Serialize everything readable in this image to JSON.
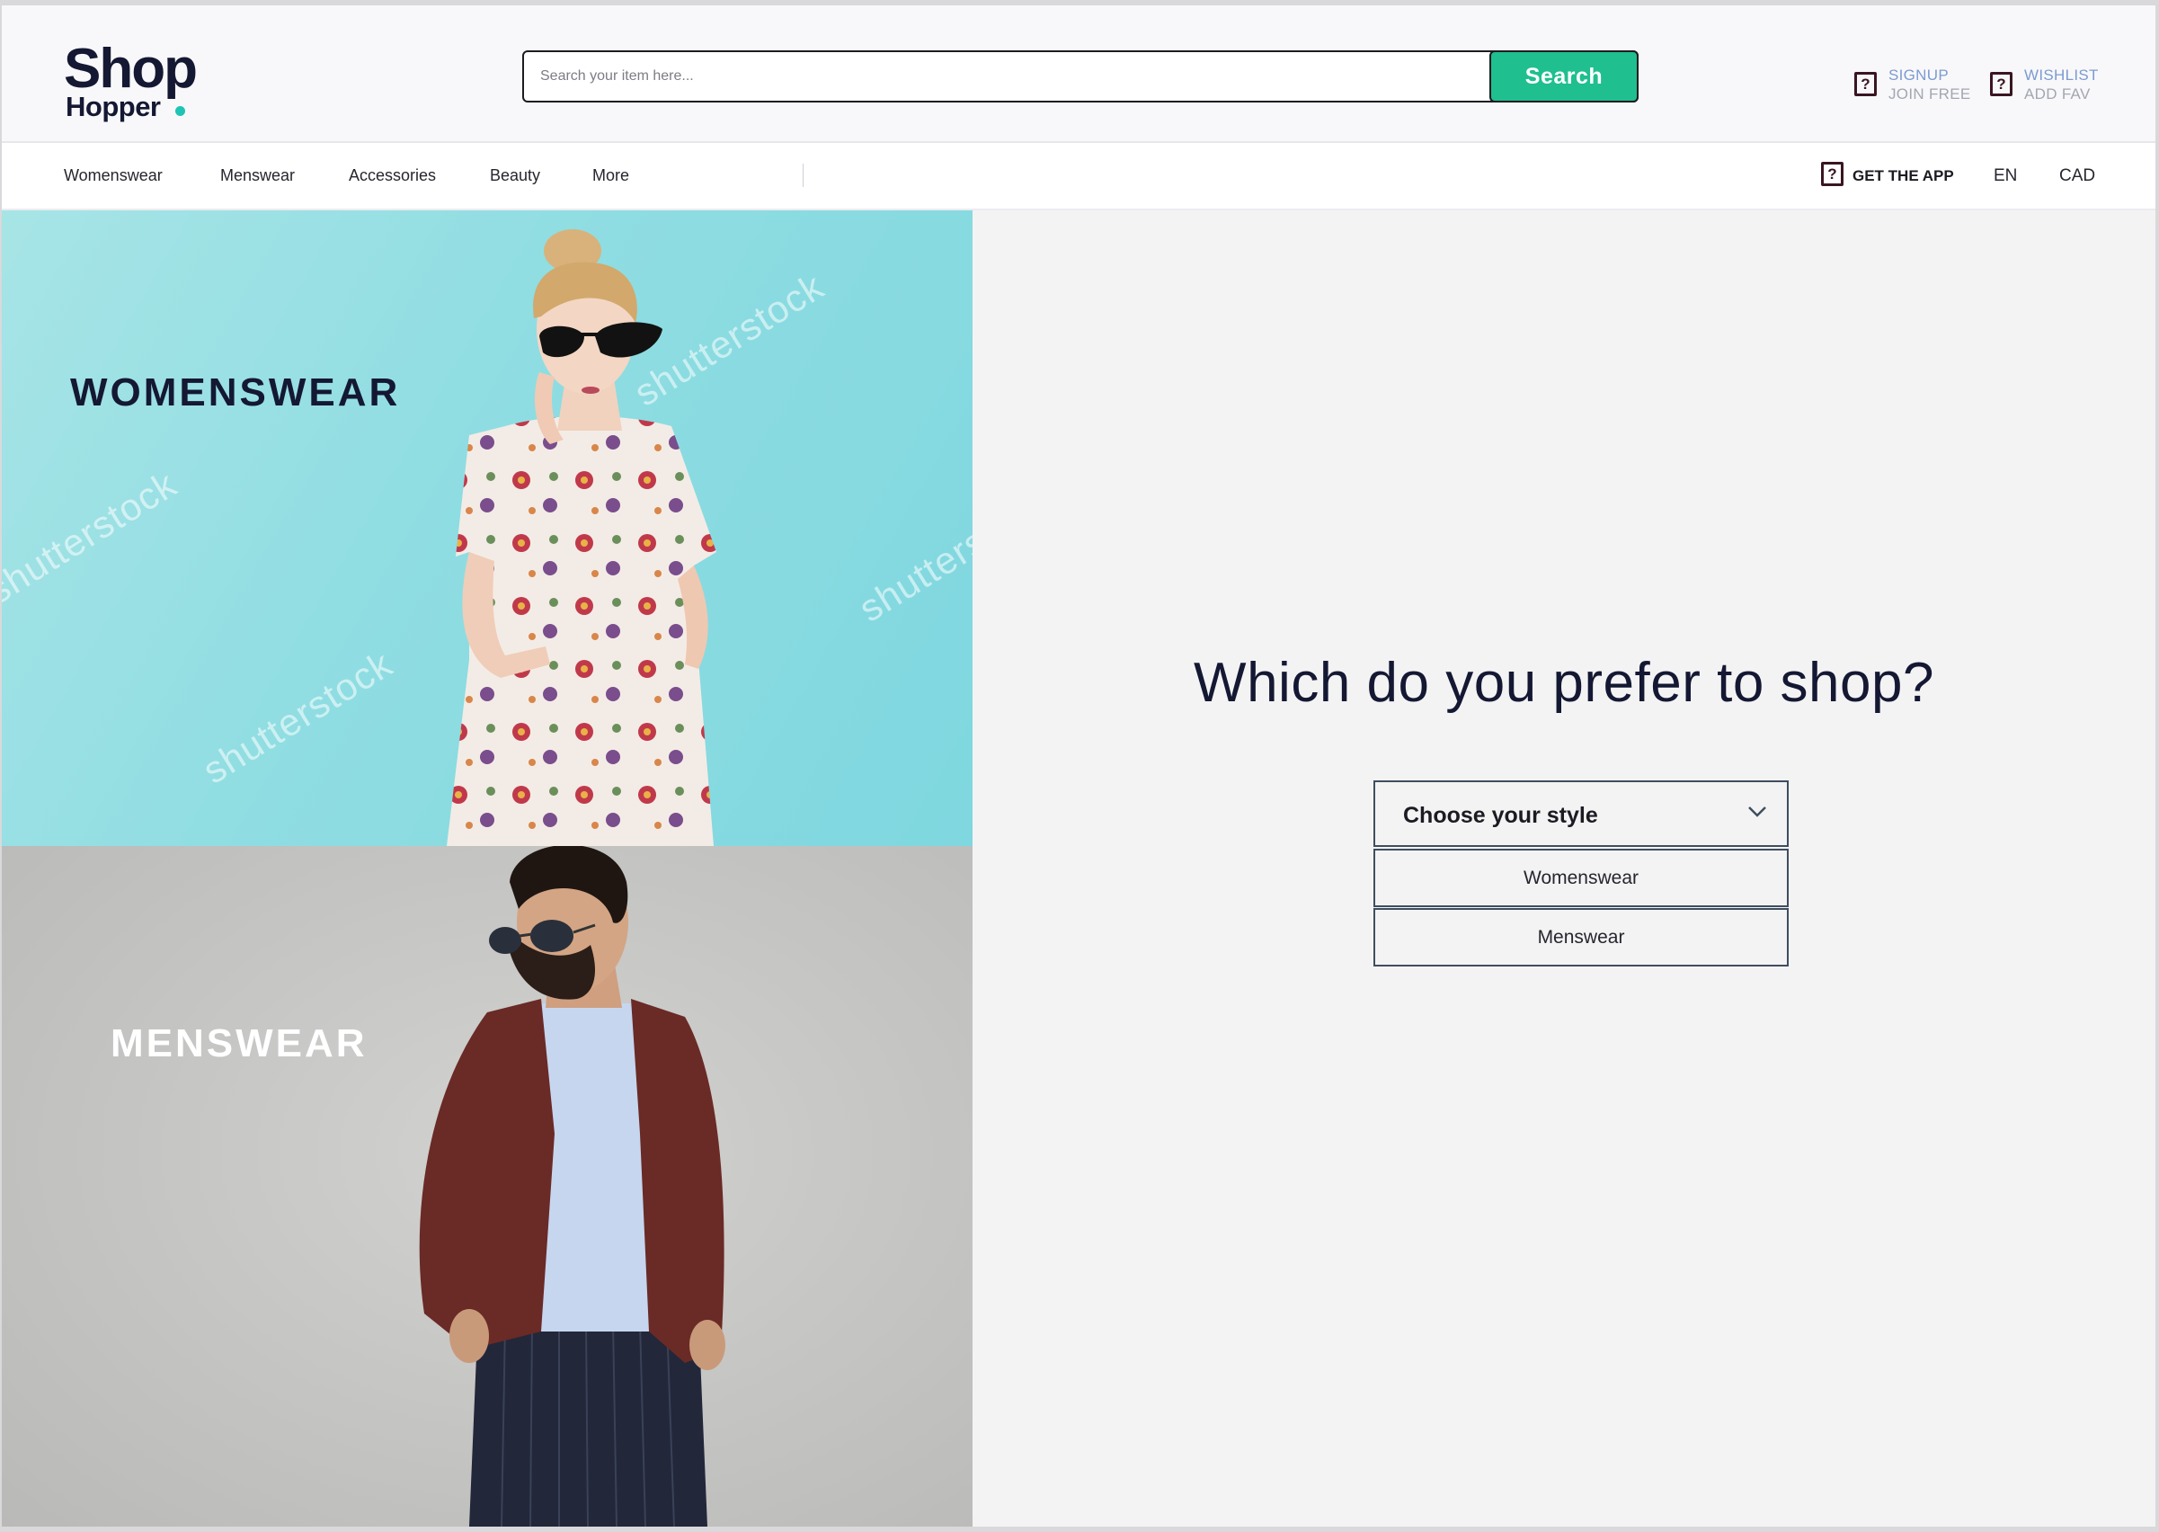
{
  "header": {
    "logo": {
      "line1": "Shop",
      "line2": "Hopper"
    },
    "search": {
      "placeholder": "Search your item here...",
      "button_label": "Search"
    },
    "signup": {
      "title": "SIGNUP",
      "subtitle": "JOIN FREE",
      "icon": "question-box-icon"
    },
    "wishlist": {
      "title": "WISHLIST",
      "subtitle": "ADD FAV",
      "icon": "question-box-icon"
    }
  },
  "nav": {
    "items": [
      "Womenswear",
      "Menswear",
      "Accessories",
      "Beauty",
      "More"
    ],
    "get_app": "GET THE APP",
    "language": "EN",
    "currency": "CAD"
  },
  "panels": {
    "women": {
      "label": "WOMENSWEAR",
      "watermark": "shutterstock"
    },
    "men": {
      "label": "MENSWEAR"
    }
  },
  "main": {
    "question": "Which do you prefer to shop?",
    "dropdown": {
      "label": "Choose your style",
      "options": [
        "Womenswear",
        "Menswear"
      ]
    }
  },
  "colors": {
    "brand_dark": "#141833",
    "accent_teal": "#1fc4b4",
    "search_button": "#1fbf8f",
    "link_blue": "#7c9bd1",
    "page_bg": "#f4f3f4"
  }
}
